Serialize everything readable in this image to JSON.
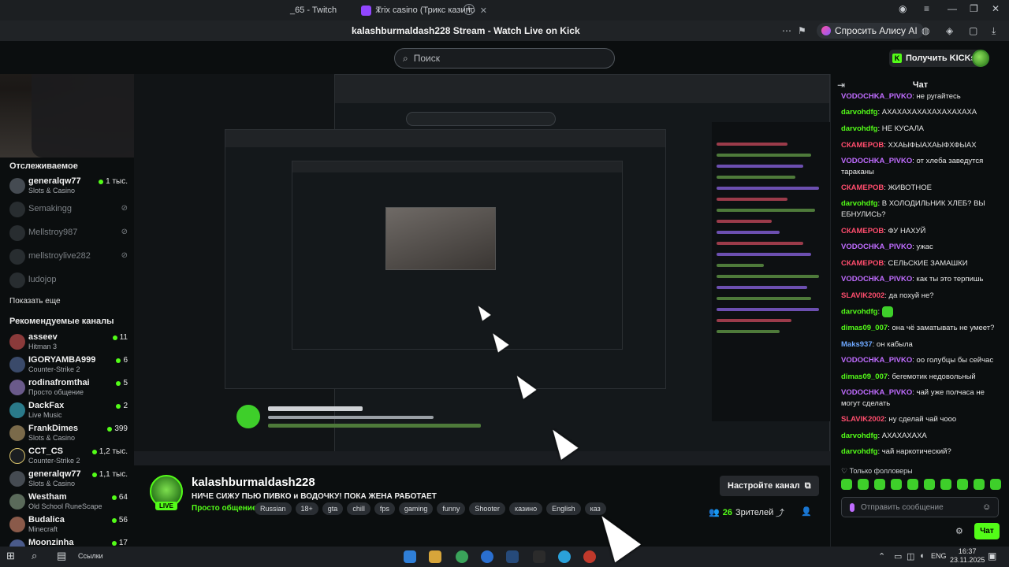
{
  "browser": {
    "tabs": [
      {
        "label": "_65 - Twitch"
      },
      {
        "label": "Trix casino (Трикс казино"
      }
    ],
    "page_title": "kalashburmaldash228 Stream - Watch Live on Kick",
    "alice_label": "Спросить Алису AI"
  },
  "header": {
    "search_placeholder": "Поиск",
    "kicks_label": "Получить KICKs"
  },
  "sidebar": {
    "following_heading": "Отслеживаемое",
    "following": [
      {
        "name": "generalqw77",
        "category": "Slots & Casino",
        "count": "1 тыс.",
        "live": true
      },
      {
        "name": "Semakingg",
        "category": "",
        "count": "",
        "live": false
      },
      {
        "name": "Mellstroy987",
        "category": "",
        "count": "",
        "live": false
      },
      {
        "name": "mellstroylive282",
        "category": "",
        "count": "",
        "live": false
      },
      {
        "name": "ludojop",
        "category": "",
        "count": "",
        "live": false
      }
    ],
    "show_more": "Показать еще",
    "recommended_heading": "Рекомендуемые каналы",
    "recommended": [
      {
        "name": "asseev",
        "category": "Hitman 3",
        "count": "11"
      },
      {
        "name": "IGORYAMBA999",
        "category": "Counter-Strike 2",
        "count": "6"
      },
      {
        "name": "rodinafromthai",
        "category": "Просто общение",
        "count": "5"
      },
      {
        "name": "DackFax",
        "category": "Live Music",
        "count": "2"
      },
      {
        "name": "FrankDimes",
        "category": "Slots & Casino",
        "count": "399"
      },
      {
        "name": "CCT_CS",
        "category": "Counter-Strike 2",
        "count": "1,2 тыс."
      },
      {
        "name": "generalqw77",
        "category": "Slots & Casino",
        "count": "1,1 тыс."
      },
      {
        "name": "Westham",
        "category": "Old School RuneScape",
        "count": "64"
      },
      {
        "name": "Budalica",
        "category": "Minecraft",
        "count": "56"
      },
      {
        "name": "Moonzinha",
        "category": "",
        "count": "17"
      }
    ]
  },
  "channel": {
    "name": "kalashburmaldash228",
    "live_badge": "LIVE",
    "title": "НИЧЕ СИЖУ ПЬЮ ПИВКО и ВОДОЧКУ! ПОКА ЖЕНА РАБОТАЕТ",
    "category": "Просто общение",
    "tags": [
      "Russian",
      "18+",
      "gta",
      "chill",
      "fps",
      "gaming",
      "funny",
      "Shooter",
      "казино",
      "English",
      "каз"
    ],
    "configure_label": "Настройте канал",
    "viewers_count": "26",
    "viewers_label": "Зрителей"
  },
  "chat": {
    "title": "Чат",
    "messages": [
      {
        "user": "VODOCHKA_PIVKO",
        "text": "не ругайтесь",
        "color": "#c06cff"
      },
      {
        "user": "darvohdfg",
        "text": "АХАХАХАХАХАХАХАХАХА",
        "color": "#53fc18"
      },
      {
        "user": "darvohdfg",
        "text": "НЕ КУСАЛА",
        "color": "#53fc18"
      },
      {
        "user": "СКАМЕРОВ",
        "text": "ХХАЫФЫАХАЫФХФЫАХ",
        "color": "#ff4d6d"
      },
      {
        "user": "VODOCHKA_PIVKO",
        "text": "от хлеба заведутся тараканы",
        "color": "#c06cff"
      },
      {
        "user": "СКАМЕРОВ",
        "text": "ЖИВОТНОЕ",
        "color": "#ff4d6d"
      },
      {
        "user": "darvohdfg",
        "text": "В ХОЛОДИЛЬНИК ХЛЕБ? ВЫ ЕБНУЛИСЬ?",
        "color": "#53fc18"
      },
      {
        "user": "СКАМЕРОВ",
        "text": "ФУ НАХУЙ",
        "color": "#ff4d6d"
      },
      {
        "user": "VODOCHKA_PIVKO",
        "text": "ужас",
        "color": "#c06cff"
      },
      {
        "user": "СКАМЕРОВ",
        "text": "СЕЛЬСКИЕ ЗАМАШКИ",
        "color": "#ff4d6d"
      },
      {
        "user": "VODOCHKA_PIVKO",
        "text": "как ты это терпишь",
        "color": "#c06cff"
      },
      {
        "user": "SLAVIK2002",
        "text": "да похуй не?",
        "color": "#ff4d6d"
      },
      {
        "user": "darvohdfg",
        "text": "",
        "color": "#53fc18"
      },
      {
        "user": "dimas09_007",
        "text": "она чё заматывать не умеет?",
        "color": "#53fc18"
      },
      {
        "user": "Maks937",
        "text": "он кабыла",
        "color": "#6ea8ff"
      },
      {
        "user": "VODOCHKA_PIVKO",
        "text": "оо голубцы бы сейчас",
        "color": "#c06cff"
      },
      {
        "user": "dimas09_007",
        "text": "бегемотик недовольный",
        "color": "#53fc18"
      },
      {
        "user": "VODOCHKA_PIVKO",
        "text": "чай уже полчаса не могут сделать",
        "color": "#c06cff"
      },
      {
        "user": "SLAVIK2002",
        "text": "ну сделай чай чооо",
        "color": "#ff4d6d"
      },
      {
        "user": "darvohdfg",
        "text": "АХАХАХАХА",
        "color": "#53fc18"
      },
      {
        "user": "darvohdfg",
        "text": "чай наркотический?",
        "color": "#53fc18"
      }
    ],
    "followers_only": "Только фолловеры",
    "input_placeholder": "Отправить сообщение",
    "send_label": "Чат"
  },
  "taskbar": {
    "links_label": "Ссылки",
    "lang": "ENG",
    "time": "16:37",
    "date": "23.11.2025"
  }
}
